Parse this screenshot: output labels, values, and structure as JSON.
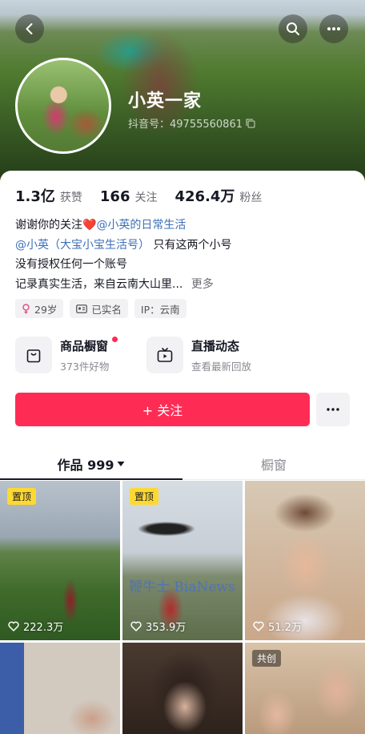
{
  "profile": {
    "name": "小英一家",
    "douyin_id": "抖音号：49755560861"
  },
  "stats": {
    "likes_value": "1.3亿",
    "likes_label": "获赞",
    "following_value": "166",
    "following_label": "关注",
    "followers_value": "426.4万",
    "followers_label": "粉丝"
  },
  "bio": {
    "line1_text": "谢谢你的关注",
    "line1_mention": "@小英的日常生活",
    "line2_mention": "@小英（大宝小宝生活号）",
    "line2_text": "只有这两个小号",
    "line3": "没有授权任何一个账号",
    "line4": "记录真实生活，来自云南大山里...",
    "more": "更多"
  },
  "tags": {
    "age": "29岁",
    "verified": "已实名",
    "ip": "IP：云南"
  },
  "shortcuts": {
    "shop_title": "商品橱窗",
    "shop_sub": "373件好物",
    "live_title": "直播动态",
    "live_sub": "查看最新回放"
  },
  "follow_button": "+ 关注",
  "tabs": {
    "works": "作品 999",
    "showcase": "橱窗"
  },
  "videos": [
    {
      "badge": "置顶",
      "likes": "222.3万"
    },
    {
      "badge": "置顶",
      "likes": "353.9万",
      "watermark": "鞭牛士 BiaNews"
    },
    {
      "badge": "",
      "likes": "51.2万"
    },
    {
      "badge": "",
      "likes": ""
    },
    {
      "badge": "",
      "likes": ""
    },
    {
      "badge": "共创",
      "likes": ""
    }
  ],
  "colors": {
    "accent": "#fe2c55",
    "mention": "#3c6fb8",
    "pin_badge": "#fdd931"
  }
}
